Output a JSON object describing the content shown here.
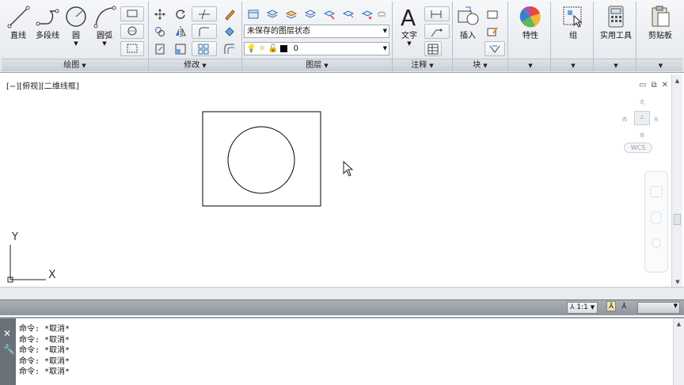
{
  "ribbon": {
    "draw": {
      "title": "绘图",
      "line_label": "直线",
      "polyline_label": "多段线",
      "circle_label": "圆",
      "arc_label": "圆弧"
    },
    "modify": {
      "title": "修改"
    },
    "layers": {
      "title": "图层",
      "layer_state": "未保存的图层状态",
      "current_layer": "0"
    },
    "annotation": {
      "title": "注释",
      "text_label": "文字"
    },
    "block": {
      "title": "块",
      "insert_label": "插入"
    },
    "properties_label": "特性",
    "group_label": "组",
    "utilities_label": "实用工具",
    "clipboard_label": "剪贴板"
  },
  "viewport": {
    "label": "[−][俯视][二维线框]",
    "viewcube": {
      "north": "北",
      "south": "南",
      "east": "东",
      "west": "西",
      "face": "上"
    },
    "wcs_label": "WCS",
    "ucs": {
      "x_label": "X",
      "y_label": "Y"
    }
  },
  "status": {
    "annotation_scale": "1:1"
  },
  "command": {
    "lines": [
      "命令: *取消*",
      "命令: *取消*",
      "命令: *取消*",
      "命令: *取消*",
      "命令: *取消*"
    ]
  },
  "icons": [
    "line-icon",
    "polyline-icon",
    "circle-icon",
    "arc-icon",
    "text-icon",
    "insert-icon",
    "properties-icon",
    "group-icon",
    "calculator-icon",
    "clipboard-icon",
    "close-icon",
    "wrench-icon"
  ],
  "colors": {
    "current_layer_color": "#000000",
    "ribbon_bg": "#e9ecf0",
    "command_handle": "#6a7178"
  }
}
